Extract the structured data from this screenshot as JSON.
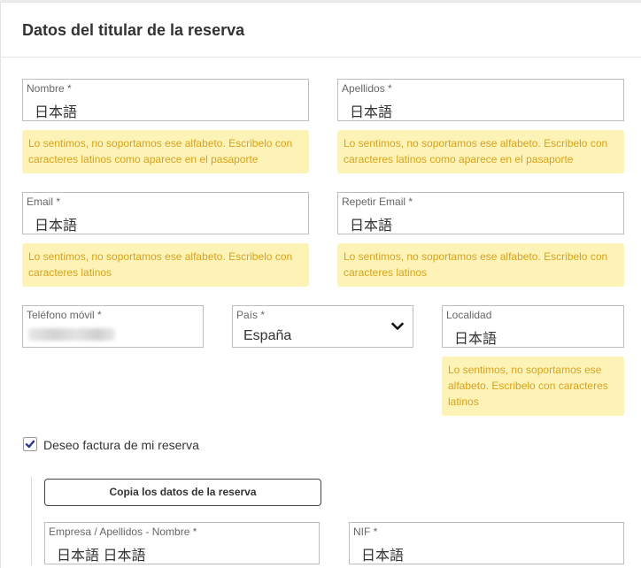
{
  "header": {
    "title": "Datos del titular de la reserva"
  },
  "fields": {
    "nombre": {
      "label": "Nombre *",
      "value": "日本語"
    },
    "apellidos": {
      "label": "Apellidos *",
      "value": "日本語"
    },
    "email": {
      "label": "Email *",
      "value": "日本語"
    },
    "repetir_email": {
      "label": "Repetir Email *",
      "value": "日本語"
    },
    "telefono": {
      "label": "Teléfono móvil *"
    },
    "pais": {
      "label": "País *",
      "value": "España"
    },
    "localidad": {
      "label": "Localidad",
      "value": "日本語"
    },
    "empresa": {
      "label": "Empresa / Apellidos - Nombre *",
      "value": "日本語 日本語"
    },
    "nif": {
      "label": "NIF *",
      "value": "日本語"
    }
  },
  "errors": {
    "nombre": "Lo sentimos, no soportamos ese alfabeto. Escribelo con caracteres latinos como aparece en el pasaporte",
    "apellidos": "Lo sentimos, no soportamos ese alfabeto. Escribelo con caracteres latinos como aparece en el pasaporte",
    "email": "Lo sentimos, no soportamos ese alfabeto. Escribelo con caracteres latinos",
    "repetir_email": "Lo sentimos, no soportamos ese alfabeto. Escribelo con caracteres latinos",
    "localidad": "Lo sentimos, no soportamos ese alfabeto. Escribelo con caracteres latinos"
  },
  "invoice": {
    "checkbox_label": "Deseo factura de mi reserva",
    "checked": true,
    "copy_button_label": "Copia los datos de la reserva"
  },
  "colors": {
    "error_bg": "#fdf3b7",
    "error_text": "#d9a21b",
    "checkbox_check": "#2b3a8c"
  },
  "icons": {
    "select": "chevron-down-icon",
    "checkbox": "checkmark-icon"
  }
}
